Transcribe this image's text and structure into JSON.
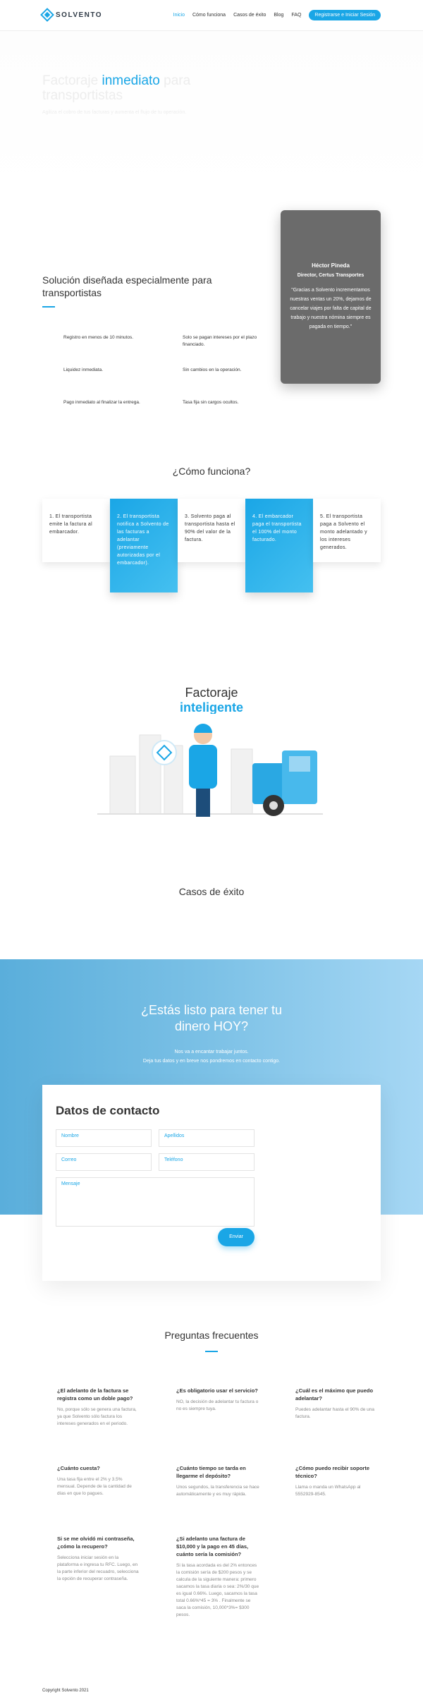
{
  "header": {
    "logo_text": "SOLVENTO",
    "nav": [
      "Inicio",
      "Cómo funciona",
      "Casos de éxito",
      "Blog",
      "FAQ"
    ],
    "cta": "Registrarse e Iniciar Sesión"
  },
  "hero": {
    "title_pre": "Factoraje",
    "title_accent": "inmediato",
    "title_post": "para transportistas",
    "subtitle": "Agiliza el cobro de tus facturas y aumenta el flujo de tu operación."
  },
  "solution": {
    "title": "Solución diseñada especialmente para transportistas",
    "features": [
      "Registro en menos de 10 minutos.",
      "Solo se pagan intereses por el plazo financiado.",
      "Liquidez inmediata.",
      "Sin cambios en la operación.",
      "Pago inmediato al finalizar la entrega.",
      "Tasa fija sin cargos ocultos."
    ]
  },
  "testimonial": {
    "name": "Héctor Pineda",
    "role": "Director, Certus Transportes",
    "quote": "\"Gracias a Solvento incrementamos nuestras ventas un 20%, dejamos de cancelar viajes por falta de capital de trabajo y nuestra nómina siempre es pagada en tiempo.\""
  },
  "how": {
    "title": "¿Cómo funciona?",
    "steps": [
      "1. El transportista emite la factura al embarcador.",
      "2. El transportista notifica a Solvento de las facturas a adelantar (previamente autorizadas por el embarcador).",
      "3. Solvento paga al transportista hasta el 90% del valor de la factura.",
      "4. El embarcador paga el transportista el 100% del monto facturado.",
      "5. El transportista paga a Solvento el monto adelantado y los intereses generados."
    ]
  },
  "factoraje": {
    "title": "Factoraje",
    "accent": "inteligente"
  },
  "casos": {
    "title": "Casos de éxito"
  },
  "band": {
    "title": "¿Estás listo para tener tu dinero HOY?",
    "sub1": "Nos va a encantar trabajar juntos.",
    "sub2": "Deja tus datos y en breve nos pondremos en contacto contigo."
  },
  "contact": {
    "title": "Datos de contacto",
    "nombre": "Nombre",
    "apellidos": "Apellidos",
    "correo": "Correo",
    "telefono": "Teléfono",
    "mensaje": "Mensaje",
    "send": "Enviar"
  },
  "faq": {
    "title": "Preguntas frecuentes",
    "items": [
      {
        "q": "¿El adelanto de la factura se registra como un doble pago?",
        "a": "No, porque sólo se genera una factura, ya que Solvento sólo factura los intereses generados en el periodo."
      },
      {
        "q": "¿Es obligatorio usar el servicio?",
        "a": "NO, la decisión de adelantar tu factura o no es siempre tuya."
      },
      {
        "q": "¿Cuál es el máximo que puedo adelantar?",
        "a": "Puedes adelantar hasta el 90% de una factura."
      },
      {
        "q": "¿Cuánto cuesta?",
        "a": "Una tasa fija entre el 2% y 3.5% mensual. Depende de la cantidad de días en que lo pagues."
      },
      {
        "q": "¿Cuánto tiempo se tarda en llegarme el depósito?",
        "a": "Unos segundos, la transferencia se hace automáticamente y es muy rápida."
      },
      {
        "q": "¿Cómo puedo recibir soporte técnico?",
        "a": "Llama o manda un WhatsApp al 5552929-8545."
      },
      {
        "q": "Si se me olvidó mi contraseña, ¿cómo la recupero?",
        "a": "Selecciona iniciar sesión en la plataforma e ingresa tu RFC. Luego, en la parte inferior del recuadro, selecciona la opción de recuperar contraseña."
      },
      {
        "q": "¿Si adelanto una factura de $10,000 y la pago en 45 días, cuánto sería la comisión?",
        "a": "Si la tasa acordada es del 2% entonces la comisión sería de $200 pesos y se calcula de la siguiente manera: primero sacamos la tasa diaria o sea: 2%/30 que es igual 0.66%. Luego, sacamos la tasa total 0.66%*45 = 3% . Finalmente se saca la comisión, 10,000*3%= $300 pesos."
      }
    ]
  },
  "footer": {
    "copyright": "Copyright Solvento 2021"
  },
  "colors": {
    "accent": "#1aa6e6",
    "testimonial_bg": "#6b6b6b"
  }
}
